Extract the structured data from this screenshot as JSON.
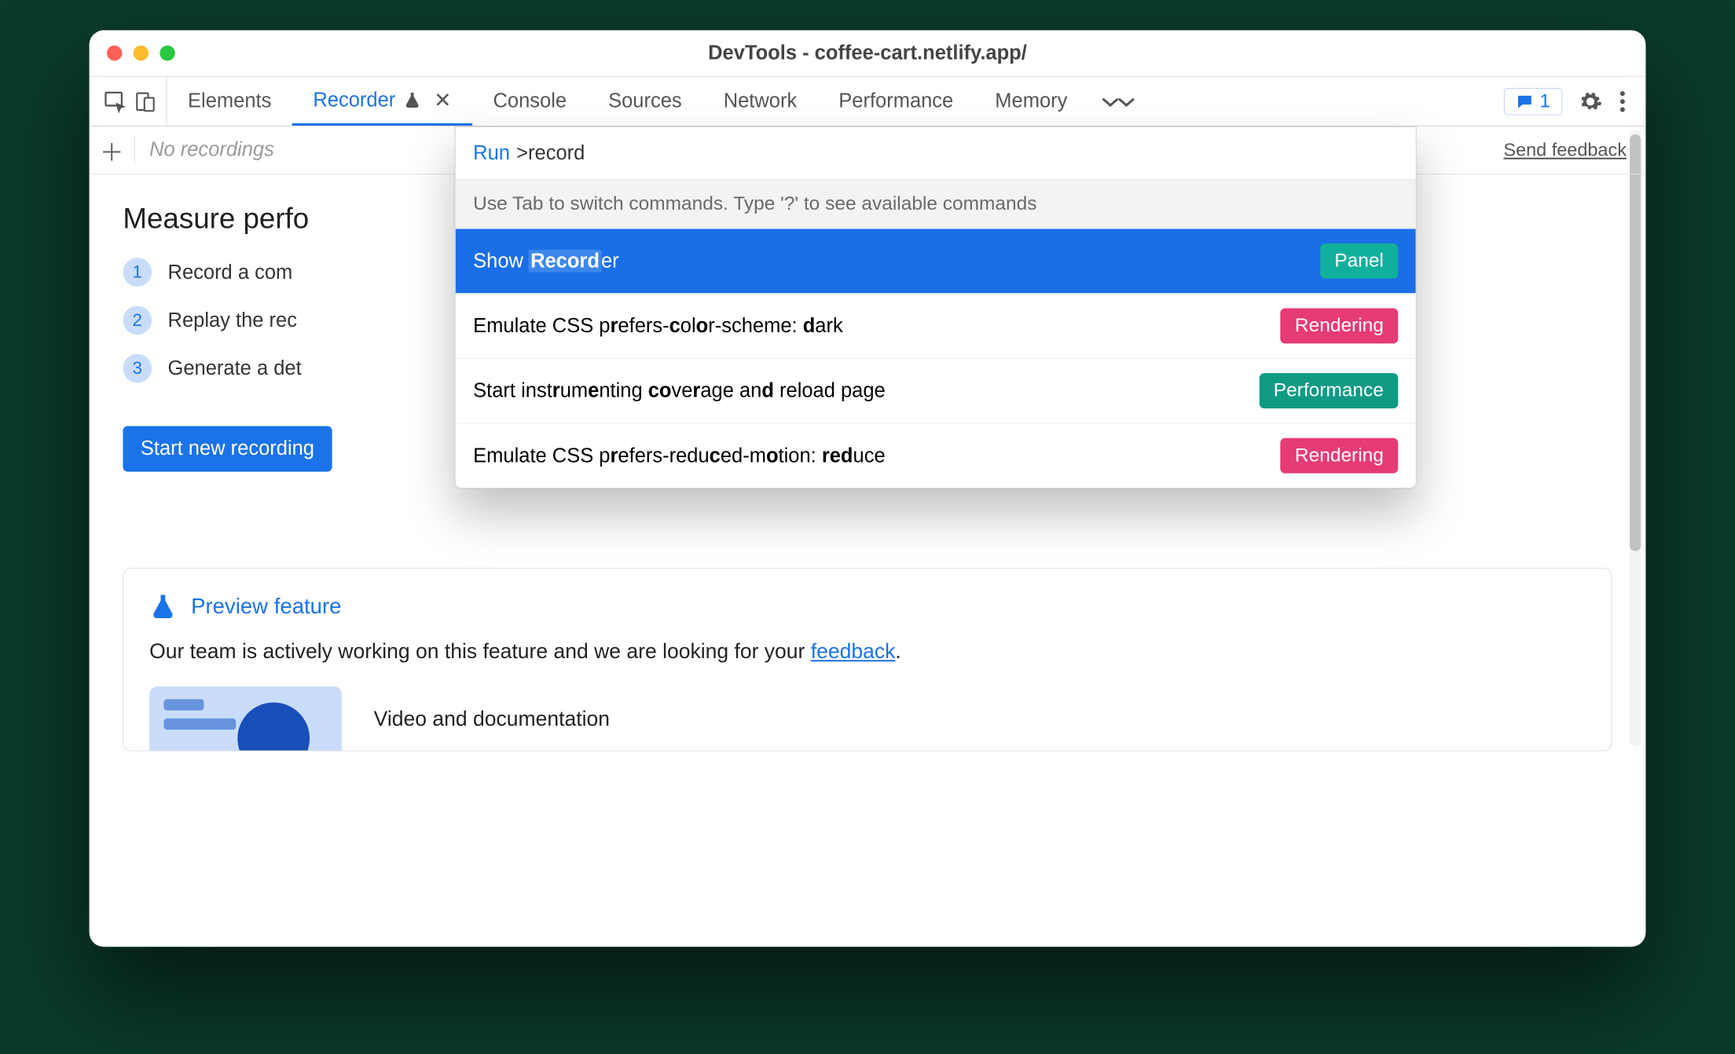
{
  "window": {
    "title": "DevTools - coffee-cart.netlify.app/"
  },
  "tabs": {
    "elements": "Elements",
    "recorder": "Recorder",
    "console": "Console",
    "sources": "Sources",
    "network": "Network",
    "performance": "Performance",
    "memory": "Memory"
  },
  "messages_count": "1",
  "secondary": {
    "no_recordings": "No recordings",
    "send_feedback": "Send feedback"
  },
  "main": {
    "heading_partial": "Measure perfo",
    "step1": "Record a com",
    "step2": "Replay the rec",
    "step3": "Generate a det",
    "start_button": "Start new recording"
  },
  "preview": {
    "title": "Preview feature",
    "body_pre": "Our team is actively working on this feature and we are looking for your ",
    "body_link": "feedback",
    "body_post": ".",
    "media_title": "Video and documentation"
  },
  "cmd": {
    "run_label": "Run",
    "query_prefix": ">",
    "query_text": "record",
    "hint": "Use Tab to switch commands. Type '?' to see available commands",
    "items": [
      {
        "html": "Show <span class='hl'><b>Record</b></span>er",
        "badge": "Panel",
        "badge_class": "panel",
        "selected": true
      },
      {
        "html": "Emulate CSS p<b>r</b>efers-<b>c</b>ol<b>o</b>r-scheme: <b>d</b>ark",
        "badge": "Rendering",
        "badge_class": "rendering",
        "selected": false
      },
      {
        "html": "Start inst<b>r</b>um<b>e</b>nting <b>co</b>ve<b>r</b>age an<b>d</b> reload page",
        "badge": "Performance",
        "badge_class": "perf",
        "selected": false
      },
      {
        "html": "Emulate CSS p<b>r</b>efers-redu<b>c</b>ed-m<b>o</b>tion: <b>red</b>uce",
        "badge": "Rendering",
        "badge_class": "rendering",
        "selected": false
      }
    ]
  }
}
